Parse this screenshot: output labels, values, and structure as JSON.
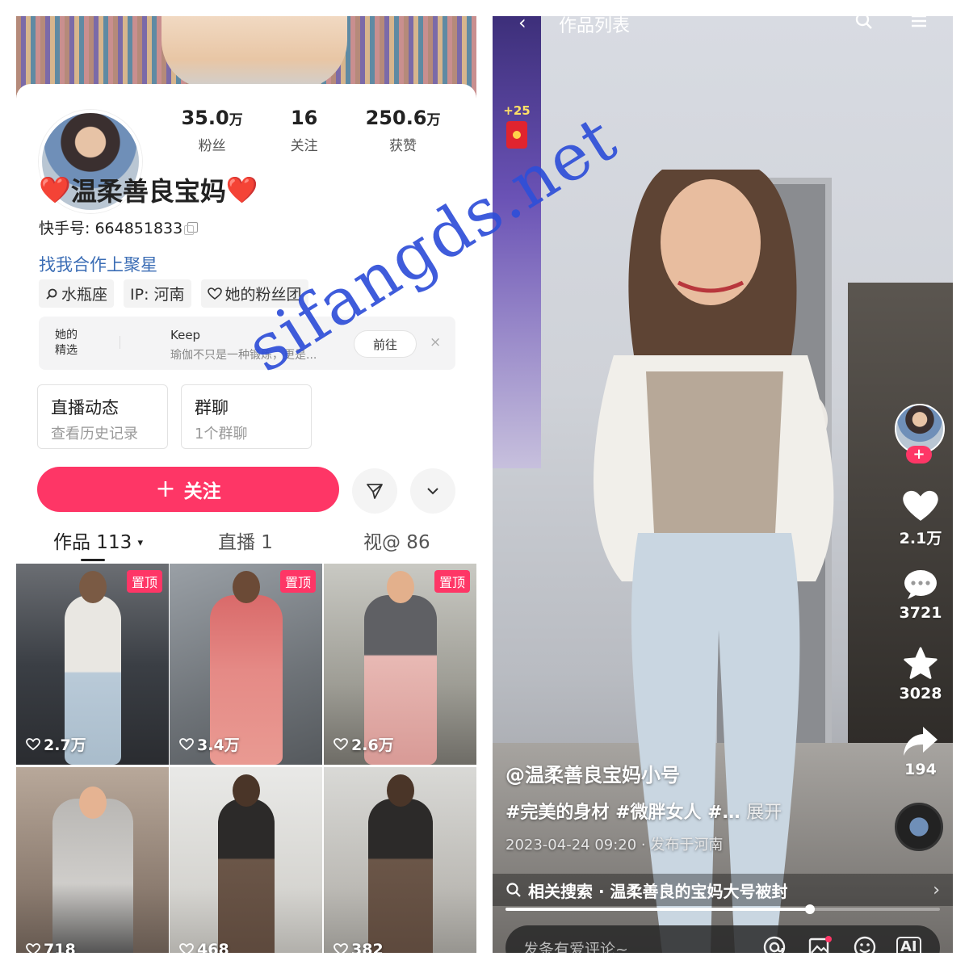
{
  "profile": {
    "stats": [
      {
        "num": "35.0",
        "unit": "万",
        "label": "粉丝"
      },
      {
        "num": "16",
        "unit": "",
        "label": "关注"
      },
      {
        "num": "250.6",
        "unit": "万",
        "label": "获赞"
      }
    ],
    "nickname": "温柔善良宝妈",
    "heart_emoji": "❤️",
    "kuaishou_id": "快手号: 664851833",
    "collab_link": "找我合作上聚星",
    "tags": [
      {
        "icon": "search-icon",
        "label": "水瓶座"
      },
      {
        "icon": "",
        "label": "IP: 河南"
      },
      {
        "icon": "heart-outline-icon",
        "label": "她的粉丝团"
      }
    ],
    "featured": {
      "title": "她的精选",
      "item_title": "Keep",
      "item_desc": "瑜伽不只是一种锻炼，更是...",
      "button": "前往",
      "close": "×"
    },
    "cards": [
      {
        "title": "直播动态",
        "sub": "查看历史记录"
      },
      {
        "title": "群聊",
        "sub": "1个群聊"
      }
    ],
    "follow_button": "关注",
    "follow_plus": "+",
    "tabs": [
      {
        "label": "作品 113",
        "caret": "▾",
        "active": true
      },
      {
        "label": "直播 1",
        "caret": "",
        "active": false
      },
      {
        "label": "视@ 86",
        "caret": "",
        "active": false
      }
    ],
    "pinned_label": "置顶",
    "grid": [
      {
        "likes": "2.7万",
        "pinned": true
      },
      {
        "likes": "3.4万",
        "pinned": true
      },
      {
        "likes": "2.6万",
        "pinned": true
      },
      {
        "likes": "718",
        "pinned": false
      },
      {
        "likes": "468",
        "pinned": false
      },
      {
        "likes": "382",
        "pinned": false
      }
    ]
  },
  "video": {
    "topbar_title": "作品列表",
    "redpack": "+25",
    "likes": "2.1万",
    "comments": "3721",
    "favorites": "3028",
    "shares": "194",
    "author": "@温柔善良宝妈小号",
    "tags_text": "#完美的身材 #微胖女人 #…",
    "expand": "展开",
    "meta": "2023-04-24 09:20 · 发布于河南",
    "related": "相关搜索 · 温柔善良的宝妈大号被封",
    "progress": 0.7,
    "comment_placeholder": "发条有爱评论~",
    "comment_icons": [
      "at-icon",
      "image-icon",
      "emoji-icon",
      "ai-icon"
    ],
    "ai_label": "AI"
  },
  "watermark": "sifangds.net",
  "colors": {
    "accent": "#fe3666",
    "link": "#3b6db5",
    "watermark": "#2f4fd8"
  }
}
